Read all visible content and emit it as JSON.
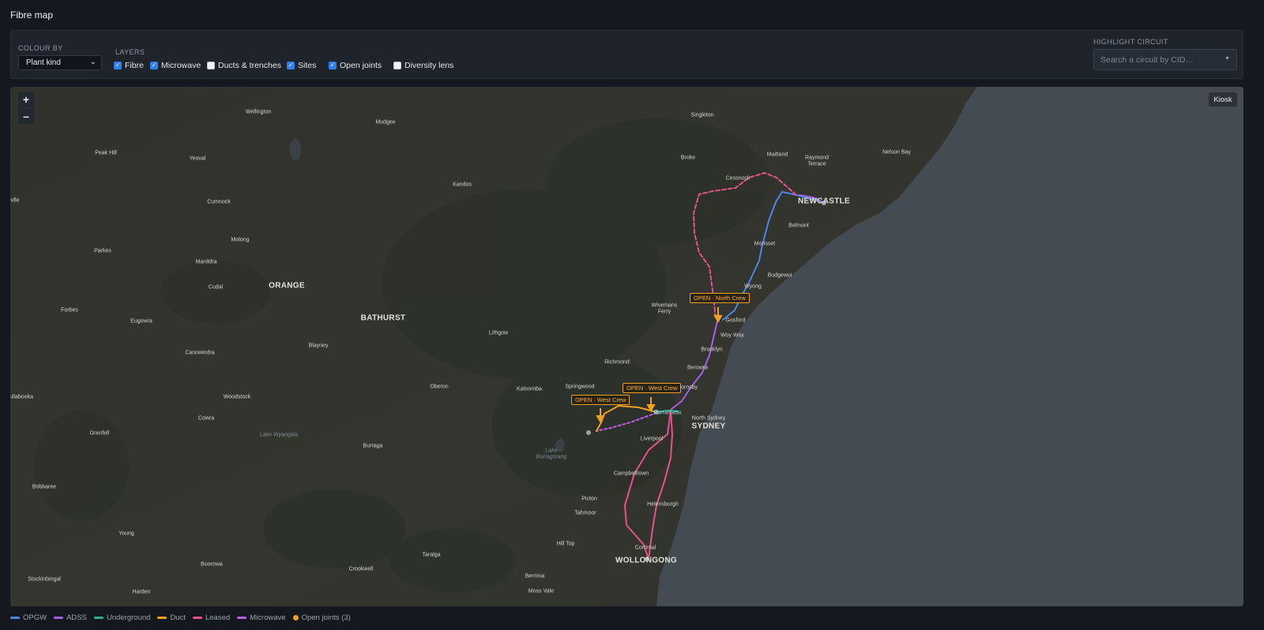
{
  "page": {
    "title": "Fibre map"
  },
  "controls": {
    "colour_by_label": "COLOUR BY",
    "colour_by_value": "Plant kind",
    "layers_label": "LAYERS",
    "layers": [
      {
        "label": "Fibre",
        "checked": true
      },
      {
        "label": "Microwave",
        "checked": true
      },
      {
        "label": "Ducts & trenches",
        "checked": false
      },
      {
        "label": "Sites",
        "checked": true
      },
      {
        "label": "Open joints",
        "checked": true
      },
      {
        "label": "Diversity lens",
        "checked": false
      }
    ],
    "highlight_label": "HIGHLIGHT CIRCUIT",
    "highlight_placeholder": "Search a circuit by CID…"
  },
  "map": {
    "zoom_in": "+",
    "zoom_out": "–",
    "kiosk": "Kiosk",
    "cities": [
      "ORANGE",
      "BATHURST",
      "SYDNEY",
      "NEWCASTLE",
      "WOLLONGONG"
    ],
    "towns": [
      "Wellington",
      "Mudgee",
      "Singleton",
      "Peak Hill",
      "Yeoval",
      "Maitland",
      "Raymond Terrace",
      "Nelson Bay",
      "Broke",
      "Cessnock",
      "Kandos",
      "Cumnock",
      "ndle",
      "Molong",
      "Parkes",
      "Manildra",
      "Belmont",
      "Morisset",
      "Cudal",
      "Budgewoi",
      "Wyong",
      "Wisemans Ferry",
      "Gosford",
      "Forbes",
      "Eugowra",
      "Woy Woy",
      "Lithgow",
      "Brooklyn",
      "Canowindra",
      "Blayney",
      "Richmond",
      "Berowra",
      "Oberon",
      "Katoomba",
      "Springwood",
      "Hornsby",
      "Woodstock",
      "Parramatta",
      "North Sydney",
      "Cowra",
      "Grenfell",
      "Burraga",
      "Liverpool",
      "Campbelltown",
      "Bribbaree",
      "Picton",
      "Helensburgh",
      "Tahmoor",
      "Young",
      "Hill Top",
      "Corrimal",
      "Boorowa",
      "Taralga",
      "Crookwell",
      "Stockinbingal",
      "Berrima",
      "Harden",
      "Moss Vale",
      "ullabooka"
    ],
    "water_labels": [
      "Lake Wyangala",
      "Lake Burragorang"
    ],
    "open_joints": [
      {
        "label": "OPEN · North Crew"
      },
      {
        "label": "OPEN · West Crew"
      },
      {
        "label": "OPEN · West Crew"
      }
    ]
  },
  "legend": [
    {
      "label": "OPGW",
      "color": "#4a86e8"
    },
    {
      "label": "ADSS",
      "color": "#a55ee8"
    },
    {
      "label": "Underground",
      "color": "#2bb58a"
    },
    {
      "label": "Duct",
      "color": "#f0a020"
    },
    {
      "label": "Leased",
      "color": "#e8508f"
    },
    {
      "label": "Microwave",
      "color": "#c05ce8"
    },
    {
      "label": "Open joints (3)",
      "color": "#f0a020"
    }
  ],
  "colors": {
    "sea": "#454b52",
    "land": "#353530",
    "panel": "#1e232c",
    "accent": "#2f7ff0"
  }
}
